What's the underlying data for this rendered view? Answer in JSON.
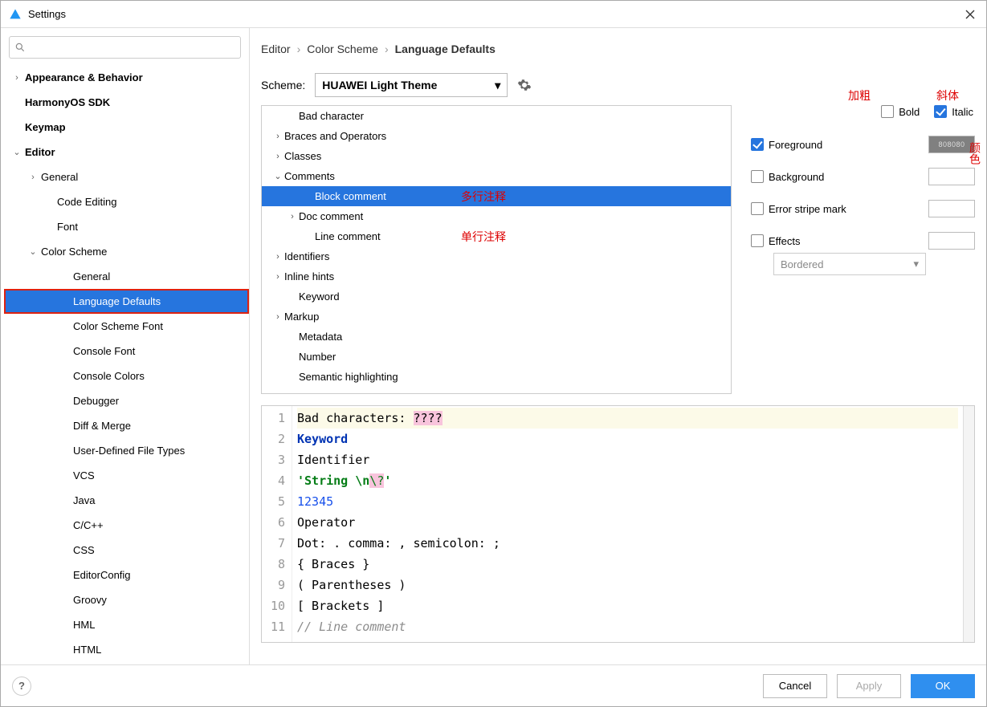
{
  "window": {
    "title": "Settings"
  },
  "breadcrumb": [
    "Editor",
    "Color Scheme",
    "Language Defaults"
  ],
  "scheme": {
    "label": "Scheme:",
    "value": "HUAWEI Light Theme"
  },
  "sidebar": {
    "items": [
      {
        "label": "Appearance & Behavior",
        "bold": true,
        "chev": ">",
        "indent": 0
      },
      {
        "label": "HarmonyOS SDK",
        "bold": true,
        "indent": 0
      },
      {
        "label": "Keymap",
        "bold": true,
        "indent": 0
      },
      {
        "label": "Editor",
        "bold": true,
        "chev": "v",
        "indent": 0
      },
      {
        "label": "General",
        "chev": ">",
        "indent": 1
      },
      {
        "label": "Code Editing",
        "indent": 2
      },
      {
        "label": "Font",
        "indent": 2
      },
      {
        "label": "Color Scheme",
        "chev": "v",
        "indent": 1
      },
      {
        "label": "General",
        "indent": 3
      },
      {
        "label": "Language Defaults",
        "indent": 3,
        "selected": true
      },
      {
        "label": "Color Scheme Font",
        "indent": 3
      },
      {
        "label": "Console Font",
        "indent": 3
      },
      {
        "label": "Console Colors",
        "indent": 3
      },
      {
        "label": "Debugger",
        "indent": 3
      },
      {
        "label": "Diff & Merge",
        "indent": 3
      },
      {
        "label": "User-Defined File Types",
        "indent": 3
      },
      {
        "label": "VCS",
        "indent": 3
      },
      {
        "label": "Java",
        "indent": 3
      },
      {
        "label": "C/C++",
        "indent": 3
      },
      {
        "label": "CSS",
        "indent": 3
      },
      {
        "label": "EditorConfig",
        "indent": 3
      },
      {
        "label": "Groovy",
        "indent": 3
      },
      {
        "label": "HML",
        "indent": 3
      },
      {
        "label": "HTML",
        "indent": 3
      }
    ]
  },
  "categories": [
    {
      "label": "Bad character",
      "indent": 1
    },
    {
      "label": "Braces and Operators",
      "chev": ">",
      "indent": 0
    },
    {
      "label": "Classes",
      "chev": ">",
      "indent": 0
    },
    {
      "label": "Comments",
      "chev": "v",
      "indent": 0
    },
    {
      "label": "Block comment",
      "indent": 2,
      "selected": true
    },
    {
      "label": "Doc comment",
      "chev": ">",
      "indent": 1
    },
    {
      "label": "Line comment",
      "indent": 2
    },
    {
      "label": "Identifiers",
      "chev": ">",
      "indent": 0
    },
    {
      "label": "Inline hints",
      "chev": ">",
      "indent": 0
    },
    {
      "label": "Keyword",
      "indent": 1
    },
    {
      "label": "Markup",
      "chev": ">",
      "indent": 0
    },
    {
      "label": "Metadata",
      "indent": 1
    },
    {
      "label": "Number",
      "indent": 1
    },
    {
      "label": "Semantic highlighting",
      "indent": 1
    }
  ],
  "options": {
    "bold": {
      "label": "Bold",
      "checked": false
    },
    "italic": {
      "label": "Italic",
      "checked": true
    },
    "foreground": {
      "label": "Foreground",
      "checked": true,
      "value": "808080",
      "swatch": "#808080"
    },
    "background": {
      "label": "Background",
      "checked": false
    },
    "errorstripe": {
      "label": "Error stripe mark",
      "checked": false
    },
    "effects": {
      "label": "Effects",
      "checked": false,
      "dropdown": "Bordered"
    }
  },
  "annotations": {
    "bold": "加粗",
    "italic": "斜体",
    "color": "颜色",
    "multiline": "多行注释",
    "singleline": "单行注释"
  },
  "preview_lines": [
    "1",
    "2",
    "3",
    "4",
    "5",
    "6",
    "7",
    "8",
    "9",
    "10",
    "11"
  ],
  "preview": {
    "l1a": "Bad characters: ",
    "l1b": "????",
    "l2": "Keyword",
    "l3": "Identifier",
    "l4a": "'String \\n",
    "l4b": "\\?",
    "l4c": "'",
    "l5": "12345",
    "l6": "Operator",
    "l7": "Dot: . comma: , semicolon: ;",
    "l8": "{ Braces }",
    "l9": "( Parentheses )",
    "l10": "[ Brackets ]",
    "l11": "// Line comment"
  },
  "buttons": {
    "cancel": "Cancel",
    "apply": "Apply",
    "ok": "OK"
  }
}
